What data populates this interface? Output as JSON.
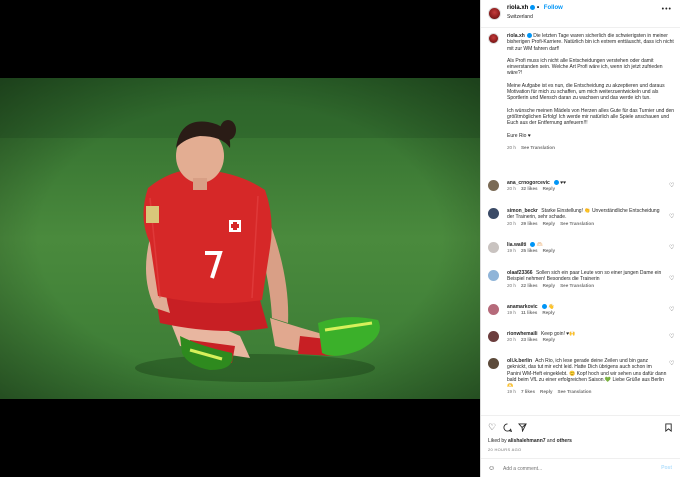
{
  "post": {
    "username": "riola.xh",
    "follow_label": "Follow",
    "separator": "•",
    "location": "Switzerland",
    "more_icon": "more-dots-icon"
  },
  "caption": {
    "username": "riola.xh",
    "paragraphs": [
      "Die letzten Tage waren sicherlich die schwierigsten in meiner bisherigen Profi-Karriere. Natürlich bin ich extrem enttäuscht, dass ich nicht mit zur WM fahren darf!",
      "Als Profi muss ich nicht alle Entscheidungen verstehen oder damit einverstanden sein. Welche Art Profi wäre ich, wenn ich jetzt zufrieden wäre?!",
      "Meine Aufgabe ist es nun, die Entscheidung zu akzeptieren und daraus Motivation für mich zu schaffen, um mich weiterzuentwickeln und als Sportlerin und Mensch daran zu wachsen und das werde ich tun.",
      "Ich wünsche meinen Mädels von Herzen alles Gute für das Turnier und den größtmöglichen Erfolg! Ich werde mir natürlich alle Spiele anschauen und Euch aus der Entfernung anfeuern!!!",
      "Eure Rio ♥"
    ],
    "time": "20 h",
    "see_translation": "See Translation"
  },
  "comments": [
    {
      "user": "ana_crnogorcevic",
      "verified": true,
      "text": "♥♥",
      "time": "20 h",
      "likes": "32 likes",
      "reply": "Reply",
      "see_translation": "",
      "avatar_color": "#7a6a55"
    },
    {
      "user": "simon_beckr",
      "verified": false,
      "text": "Starke Einstellung! 👏 Unverständliche Entscheidung der Trainerin, sehr schade.",
      "time": "20 h",
      "likes": "29 likes",
      "reply": "Reply",
      "see_translation": "See Translation",
      "avatar_color": "#3a4a66"
    },
    {
      "user": "lia.wailti",
      "verified": true,
      "text": "🫶🏻",
      "time": "19 h",
      "likes": "25 likes",
      "reply": "Reply",
      "see_translation": "",
      "avatar_color": "#c9c3c0"
    },
    {
      "user": "olaaf23366",
      "verified": false,
      "text": "Sollen sich ein paar Leute von so einer jungen Dame ein Beispiel nehmen! Besonders die Trainerin",
      "time": "20 h",
      "likes": "22 likes",
      "reply": "Reply",
      "see_translation": "See Translation",
      "avatar_color": "#8fb4d8"
    },
    {
      "user": "anamarkovic",
      "verified": true,
      "text": "👋",
      "time": "19 h",
      "likes": "11 likes",
      "reply": "Reply",
      "see_translation": "",
      "avatar_color": "#b56a7a"
    },
    {
      "user": "rionwhemaili",
      "verified": false,
      "text": "Keep goin! ♥🙌",
      "time": "20 h",
      "likes": "23 likes",
      "reply": "Reply",
      "see_translation": "",
      "avatar_color": "#6b3d3d"
    },
    {
      "user": "oli.k.berlin",
      "verified": false,
      "text": "Ach Rio, ich lese gerade deine Zeilen und bin ganz geknickt, das tut mir echt leid. Hatte Dich übrigens auch schon im Panini WM-Heft eingeklebt. 😊 Kopf hoch und wir sehen uns dafür dann bald beim VfL zu einer erfolgreichen Saison.💚 Liebe Grüße aus Berlin 🫶",
      "time": "19 h",
      "likes": "7 likes",
      "reply": "Reply",
      "see_translation": "See Translation",
      "avatar_color": "#5c4a3a"
    }
  ],
  "actions": {
    "icons": [
      "heart-icon",
      "comment-icon",
      "share-icon",
      "bookmark-icon"
    ],
    "liked_prefix": "Liked by",
    "liked_user": "alishalehmann7",
    "liked_and": "and",
    "liked_others": "others",
    "time_ago": "20 HOURS AGO"
  },
  "add_comment": {
    "placeholder": "Add a comment...",
    "post_label": "Post"
  },
  "colors": {
    "accent": "#0095f6",
    "jersey": "#d62828",
    "pitch": "#3f7e37"
  }
}
